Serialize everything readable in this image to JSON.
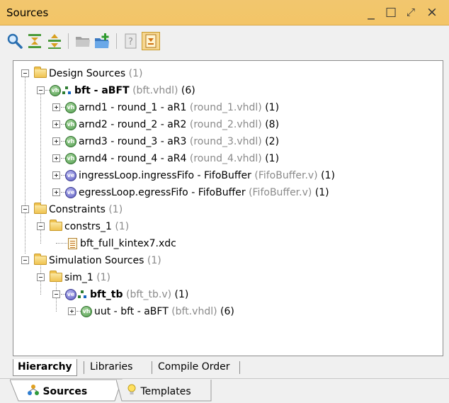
{
  "window": {
    "title": "Sources",
    "controls": {
      "minimize": "_",
      "maximize": "□",
      "float": "⤢",
      "close": "×"
    }
  },
  "toolbar": {
    "buttons": [
      {
        "name": "search",
        "icon": "search-icon"
      },
      {
        "name": "collapse-all",
        "icon": "collapse-all-icon"
      },
      {
        "name": "expand-all",
        "icon": "expand-all-icon"
      },
      {
        "name": "show-hierarchy",
        "icon": "folder-icon"
      },
      {
        "name": "add-sources",
        "icon": "add-sources-icon"
      },
      {
        "name": "properties",
        "icon": "properties-icon"
      },
      {
        "name": "set-top",
        "icon": "set-top-icon"
      }
    ]
  },
  "tree": {
    "design_sources": {
      "label": "Design Sources",
      "count": "(1)"
    },
    "bft": {
      "label": "bft - aBFT",
      "file": "(bft.vhdl)",
      "count": "(6)",
      "badge": "vh"
    },
    "arnd1": {
      "label": "arnd1 - round_1 - aR1",
      "file": "(round_1.vhdl)",
      "count": "(1)",
      "badge": "vh"
    },
    "arnd2": {
      "label": "arnd2 - round_2 - aR2",
      "file": "(round_2.vhdl)",
      "count": "(8)",
      "badge": "vh"
    },
    "arnd3": {
      "label": "arnd3 - round_3 - aR3",
      "file": "(round_3.vhdl)",
      "count": "(2)",
      "badge": "vh"
    },
    "arnd4": {
      "label": "arnd4 - round_4 - aR4",
      "file": "(round_4.vhdl)",
      "count": "(1)",
      "badge": "vh"
    },
    "ingress": {
      "label": "ingressLoop.ingressFifo - FifoBuffer",
      "file": "(FifoBuffer.v)",
      "count": "(1)",
      "badge": "ve"
    },
    "egress": {
      "label": "egressLoop.egressFifo - FifoBuffer",
      "file": "(FifoBuffer.v)",
      "count": "(1)",
      "badge": "ve"
    },
    "constraints": {
      "label": "Constraints",
      "count": "(1)"
    },
    "constrs_1": {
      "label": "constrs_1",
      "count": "(1)"
    },
    "xdc": {
      "label": "bft_full_kintex7.xdc"
    },
    "sim_sources": {
      "label": "Simulation Sources",
      "count": "(1)"
    },
    "sim_1": {
      "label": "sim_1",
      "count": "(1)"
    },
    "bft_tb": {
      "label": "bft_tb",
      "file": "(bft_tb.v)",
      "count": "(1)",
      "badge": "ve"
    },
    "uut": {
      "label": "uut - bft - aBFT",
      "file": "(bft.vhdl)",
      "count": "(6)",
      "badge": "vh"
    }
  },
  "view_tabs": [
    {
      "label": "Hierarchy"
    },
    {
      "label": "Libraries"
    },
    {
      "label": "Compile Order"
    }
  ],
  "bottom_tabs": [
    {
      "label": "Sources"
    },
    {
      "label": "Templates"
    }
  ]
}
